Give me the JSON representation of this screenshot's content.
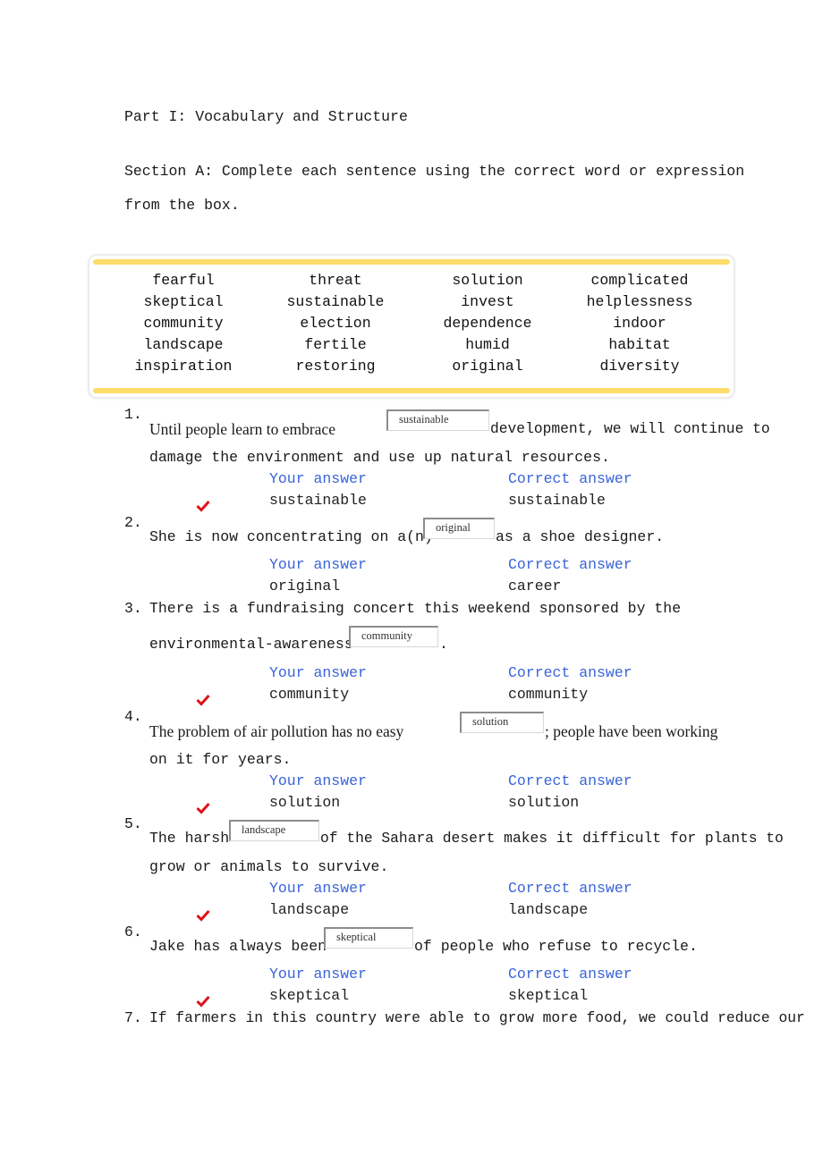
{
  "part_title": "Part I: Vocabulary and Structure",
  "section_instruction_line1": "Section A: Complete each sentence using the correct word or expression",
  "section_instruction_line2": "from the box.",
  "word_box": {
    "accent_color": "#fddc6a",
    "words": [
      "fearful",
      "threat",
      "solution",
      "complicated",
      "skeptical",
      "sustainable",
      "invest",
      "helplessness",
      "community",
      "election",
      "dependence",
      "indoor",
      "landscape",
      "fertile",
      "humid",
      "habitat",
      "inspiration",
      "restoring",
      "original",
      "diversity"
    ]
  },
  "labels": {
    "your_answer": "Your answer",
    "correct_answer": "Correct answer",
    "label_color": "#3a64d8",
    "check_color": "#e0101a"
  },
  "questions": [
    {
      "number": "1.",
      "before": "Until people learn to embrace",
      "input_value": "sustainable",
      "after": "development, we will continue to",
      "line2": "damage the environment and use up natural resources.",
      "your_answer": "sustainable",
      "correct_answer": "sustainable",
      "is_correct": true
    },
    {
      "number": "2.",
      "before": "She is now concentrating on a(n)",
      "input_value": "original",
      "after": "as a shoe designer.",
      "your_answer": "original",
      "correct_answer": "career",
      "is_correct": false
    },
    {
      "number": "3.",
      "line1": "There is a fundraising concert this weekend sponsored by the",
      "before": "environmental-awareness",
      "input_value": "community",
      "after": ".",
      "your_answer": "community",
      "correct_answer": "community",
      "is_correct": true
    },
    {
      "number": "4.",
      "before": "The problem of air pollution has no easy",
      "input_value": "solution",
      "after": "; people have been working",
      "line2": "on it for years.",
      "your_answer": "solution",
      "correct_answer": "solution",
      "is_correct": true
    },
    {
      "number": "5.",
      "before": "The harsh",
      "input_value": "landscape",
      "after": "of the Sahara desert makes it difficult for plants to",
      "line2": "grow or animals to survive.",
      "your_answer": "landscape",
      "correct_answer": "landscape",
      "is_correct": true
    },
    {
      "number": "6.",
      "before": "Jake has always been",
      "input_value": "skeptical",
      "after": "of people who refuse to recycle.",
      "your_answer": "skeptical",
      "correct_answer": "skeptical",
      "is_correct": true
    },
    {
      "number": "7.",
      "line1": "If farmers in this country were able to grow more food, we could reduce our"
    }
  ]
}
